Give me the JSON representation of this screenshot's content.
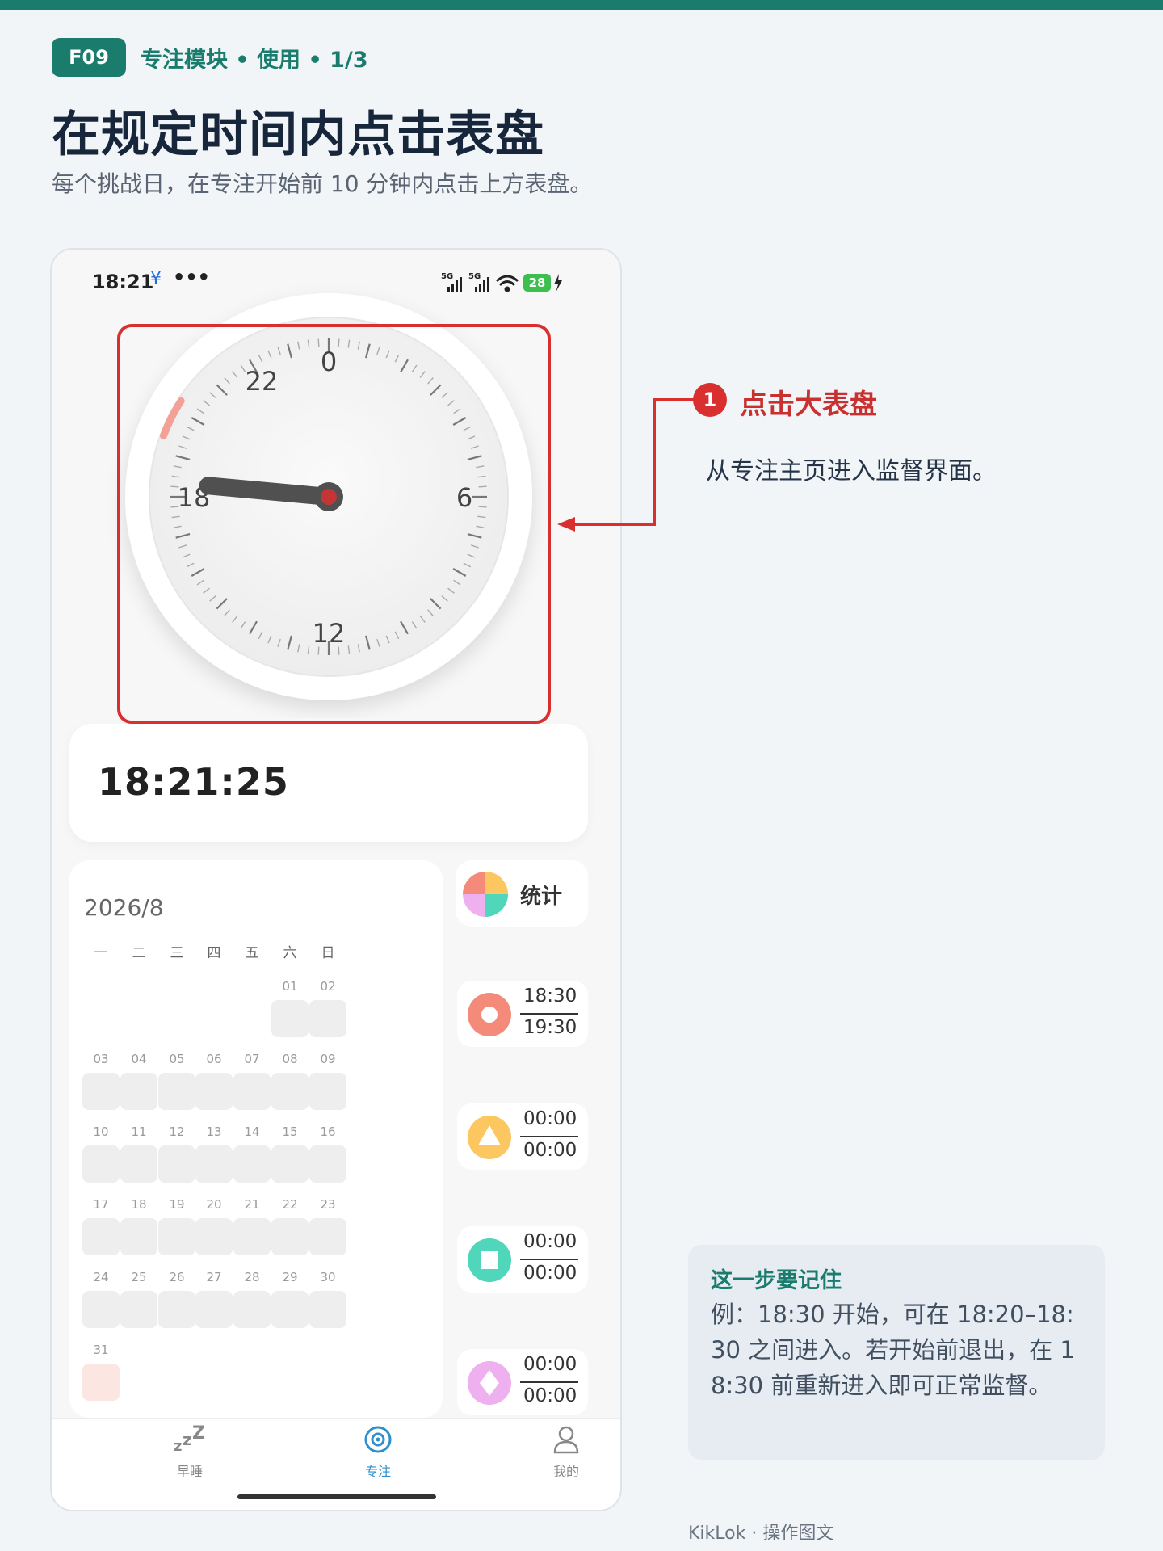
{
  "header": {
    "badge": "F09",
    "breadcrumb": "专注模块 • 使用 • 1/3",
    "title": "在规定时间内点击表盘",
    "subtitle": "每个挑战日，在专注开始前 10 分钟内点击上方表盘。"
  },
  "phone": {
    "status": {
      "time": "18:21",
      "extra_icon": "¥",
      "dots": "•••",
      "battery": "28"
    },
    "dial": {
      "labels": [
        "0",
        "6",
        "12",
        "18",
        "22"
      ],
      "hand_hour": 18.35
    },
    "current_time": "18:21:25",
    "calendar": {
      "month": "2026/8",
      "weekdays": [
        "一",
        "二",
        "三",
        "四",
        "五",
        "六",
        "日"
      ],
      "days": [
        "01",
        "02",
        "03",
        "04",
        "05",
        "06",
        "07",
        "08",
        "09",
        "10",
        "11",
        "12",
        "13",
        "14",
        "15",
        "16",
        "17",
        "18",
        "19",
        "20",
        "21",
        "22",
        "23",
        "24",
        "25",
        "26",
        "27",
        "28",
        "29",
        "30",
        "31"
      ],
      "today": "31"
    },
    "stats_label": "统计",
    "slots": [
      {
        "icon": "circle-icon",
        "color": "#f48b7a",
        "start": "18:30",
        "end": "19:30"
      },
      {
        "icon": "triangle-icon",
        "color": "#fcc760",
        "start": "00:00",
        "end": "00:00"
      },
      {
        "icon": "square-icon",
        "color": "#4fd6bb",
        "start": "00:00",
        "end": "00:00"
      },
      {
        "icon": "diamond-icon",
        "color": "#eeb0ee",
        "start": "00:00",
        "end": "00:00"
      }
    ],
    "tabs": [
      {
        "label": "早睡",
        "icon": "sleep-zzz-icon"
      },
      {
        "label": "专注",
        "icon": "focus-target-icon",
        "active": true
      },
      {
        "label": "我的",
        "icon": "person-icon"
      }
    ]
  },
  "annotation": {
    "number": "1",
    "title": "点击大表盘",
    "description": "从专注主页进入监督界面。",
    "color": "#d9302f"
  },
  "note": {
    "title": "这一步要记住",
    "text": "例：18:30 开始，可在 18:20–18:30 之间进入。若开始前退出，在 18:30 前重新进入即可正常监督。"
  },
  "footer": "KikLok · 操作图文",
  "colors": {
    "brand": "#1a7c6c",
    "accent": "#d9302f"
  }
}
